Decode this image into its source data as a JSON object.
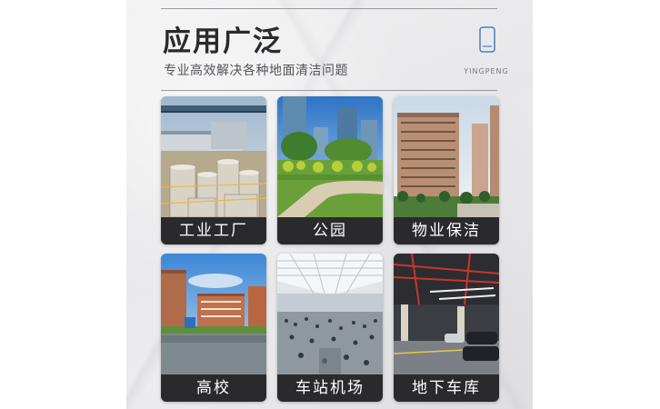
{
  "header": {
    "title": "应用广泛",
    "subtitle": "专业高效解决各种地面清洁问题",
    "brand": "YINGPENG"
  },
  "cards": [
    {
      "label": "工业工厂",
      "icon": "factory-photo"
    },
    {
      "label": "公园",
      "icon": "park-photo"
    },
    {
      "label": "物业保洁",
      "icon": "residential-building-photo"
    },
    {
      "label": "高校",
      "icon": "university-campus-photo"
    },
    {
      "label": "车站机场",
      "icon": "station-hall-photo"
    },
    {
      "label": "地下车库",
      "icon": "underground-garage-photo"
    }
  ],
  "colors": {
    "label_bg": "#2a2a2c",
    "label_text": "#ffffff",
    "brand_icon": "#4a7fc1"
  }
}
